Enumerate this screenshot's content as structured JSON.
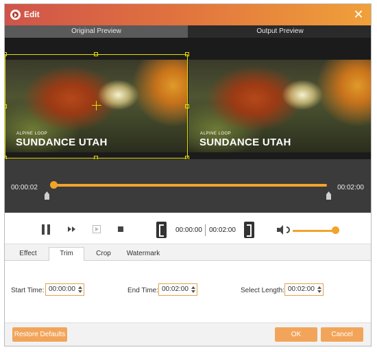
{
  "window": {
    "title": "Edit",
    "close_glyph": "✕"
  },
  "preview": {
    "original_label": "Original Preview",
    "output_label": "Output Preview",
    "video_subtitle": "ALPINE LOOP",
    "video_title": "SUNDANCE UTAH"
  },
  "timeline": {
    "current_time": "00:00:02",
    "end_time": "00:02:00"
  },
  "controls": {
    "trim_start": "00:00:00",
    "trim_end": "00:02:00",
    "volume_level": 1.0
  },
  "tabs": [
    {
      "label": "Effect",
      "active": false
    },
    {
      "label": "Trim",
      "active": true
    },
    {
      "label": "Crop",
      "active": false
    },
    {
      "label": "Watermark",
      "active": false
    }
  ],
  "trim": {
    "start_label": "Start Time:",
    "start_value": "00:00:00",
    "end_label": "End Time:",
    "end_value": "00:02:00",
    "length_label": "Select Length:",
    "length_value": "00:02:00"
  },
  "footer": {
    "restore_label": "Restore Defaults",
    "ok_label": "OK",
    "cancel_label": "Cancel"
  },
  "colors": {
    "accent": "#f2a32a",
    "button": "#f2a55a",
    "crop_frame": "#e8e000"
  }
}
